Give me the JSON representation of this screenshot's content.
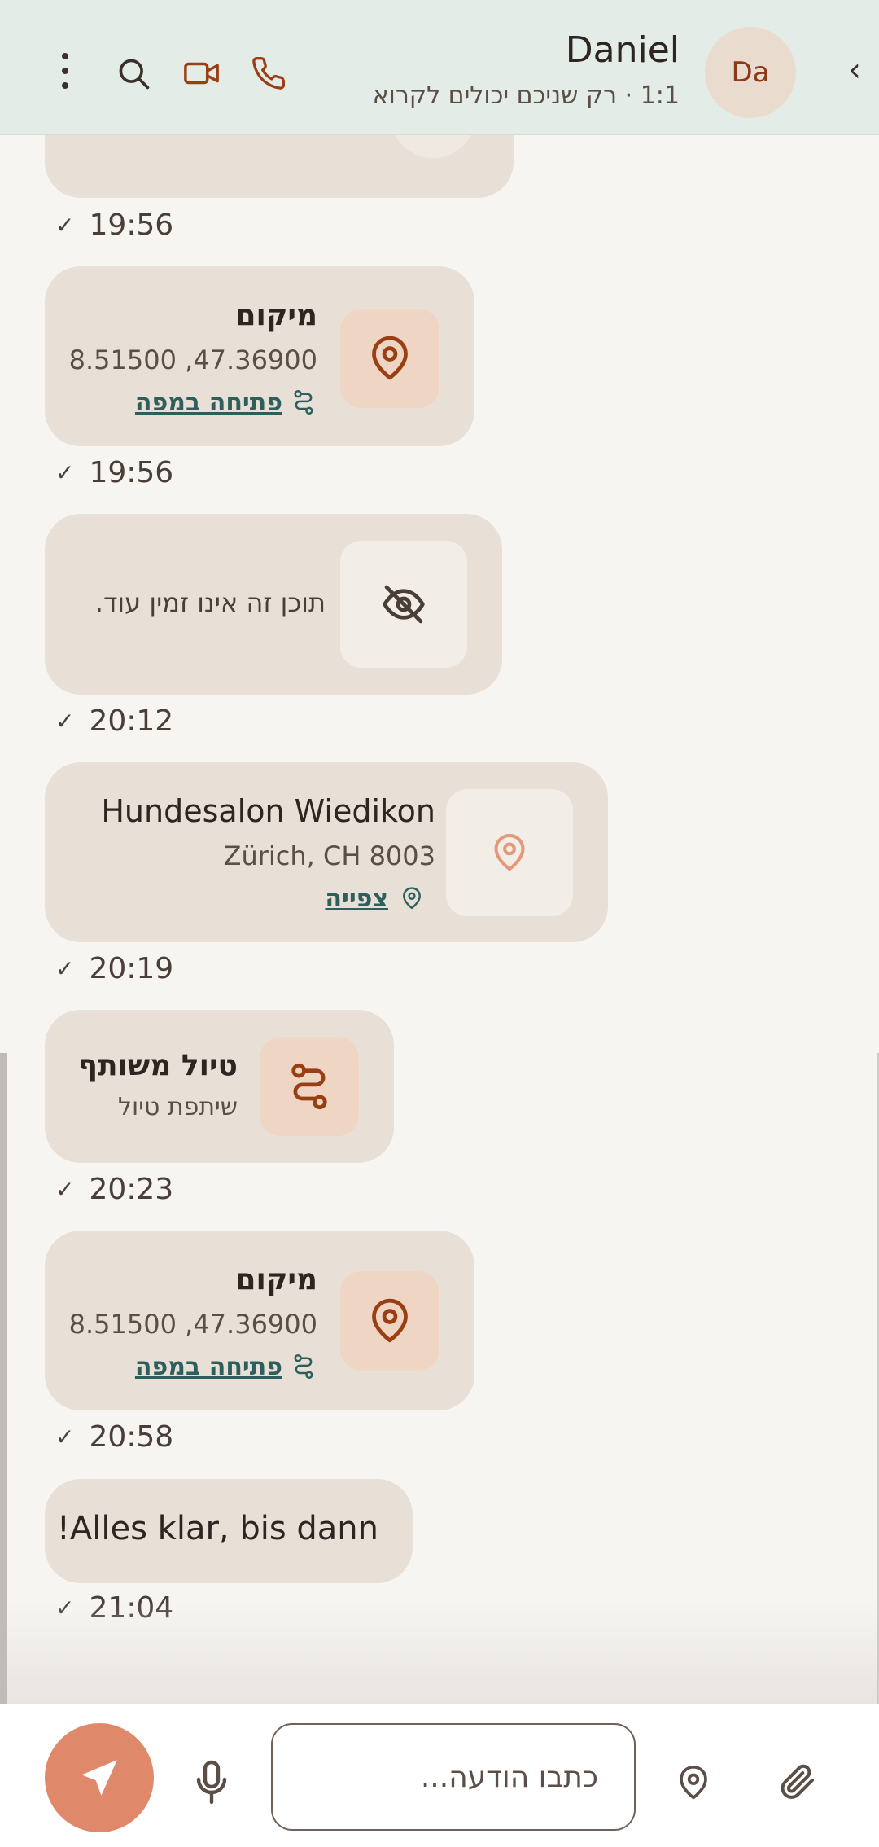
{
  "header": {
    "back_glyph": "‹",
    "avatar_initials": "Da",
    "name": "Daniel",
    "subtitle": "1:1 · רק שניכם יכולים לקרוא"
  },
  "messages": [
    {
      "time": "19:56"
    },
    {
      "title": "מיקום",
      "coords": "8.51500 ,47.36900",
      "link": "פתיחה במפה",
      "time": "19:56"
    },
    {
      "text": "תוכן זה אינו זמין עוד.",
      "time": "20:12"
    },
    {
      "title": "Hundesalon Wiedikon",
      "address": "Zürich, CH 8003",
      "link": "צפייה",
      "time": "20:19"
    },
    {
      "title": "טיול משותף",
      "subtitle": "שיתפת טיול",
      "time": "20:23"
    },
    {
      "title": "מיקום",
      "coords": "8.51500 ,47.36900",
      "link": "פתיחה במפה",
      "time": "20:58"
    },
    {
      "text": "!Alles klar, bis dann",
      "time": "21:04"
    }
  ],
  "composer": {
    "placeholder": "כתבו הודעה..."
  },
  "colors": {
    "header_bg": "#e4ece7",
    "chat_bg": "#f7f5f1",
    "bubble_bg": "#e8e0d7",
    "accent": "#e0896a",
    "icon_brown": "#9a3f14",
    "link_teal": "#2d5f5d"
  },
  "icons": {
    "back": "chevron-left-icon",
    "call": "phone-icon",
    "video": "video-camera-icon",
    "search": "search-icon",
    "menu": "more-vertical-icon",
    "location": "map-pin-icon",
    "route": "route-icon",
    "hidden": "eye-off-icon",
    "send": "send-icon",
    "mic": "microphone-icon",
    "attach": "paperclip-icon"
  }
}
